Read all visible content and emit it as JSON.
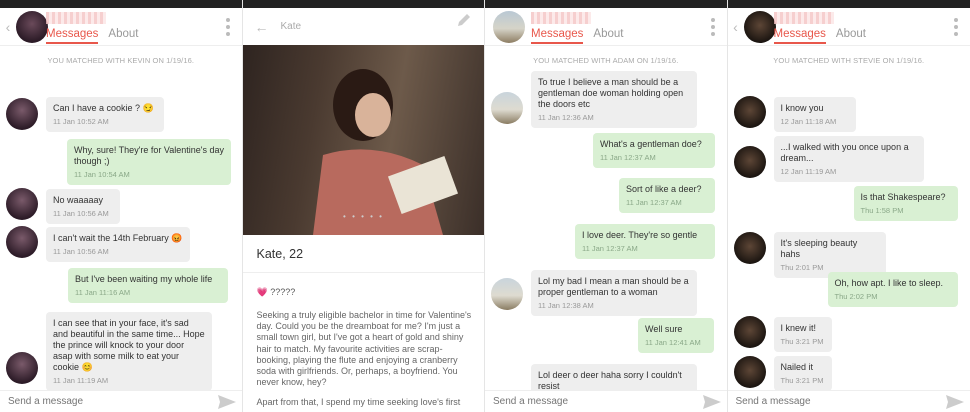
{
  "tabs": {
    "messages": "Messages",
    "about": "About"
  },
  "input_placeholder": "Send a message",
  "panel1": {
    "matched": "YOU MATCHED WITH KEVIN ON 1/19/16.",
    "messages": [
      {
        "dir": "in",
        "text": "Can I have a cookie ? 😏",
        "time": "11 Jan 10:52 AM"
      },
      {
        "dir": "out",
        "text": "Why, sure! They're for Valentine's day though ;)",
        "time": "11 Jan 10:54 AM"
      },
      {
        "dir": "in",
        "text": "No waaaaay",
        "time": "11 Jan 10:56 AM"
      },
      {
        "dir": "in",
        "text": "I can't wait the 14th February 😡",
        "time": "11 Jan 10:56 AM"
      },
      {
        "dir": "out",
        "text": "But I've been waiting my whole life",
        "time": "11 Jan 11:16 AM"
      },
      {
        "dir": "in",
        "text": "I can see that in your face, it's sad and beautiful in the same time... Hope the prince will knock to your door asap with some milk to eat your cookie 😊",
        "time": "11 Jan 11:19 AM"
      }
    ]
  },
  "panel2": {
    "header_name": "Kate",
    "title": "Kate, 22",
    "status": "💗 ?????",
    "bio": "Seeking a truly eligible bachelor in time for Valentine's day. Could you be the dreamboat for me? I'm just a small town girl, but I've got a heart of gold and shiny hair to match. My favourite activities are scrap-booking, playing the flute and enjoying a cranberry soda with girlfriends. Or, perhaps, a boyfriend. You never know, hey?",
    "bio2": "Apart from that, I spend my time seeking love's first",
    "photo_dots": "• • • • •"
  },
  "panel3": {
    "matched": "YOU MATCHED WITH ADAM ON 1/19/16.",
    "messages": [
      {
        "dir": "in",
        "text": "To true I believe a man should be a gentleman doe woman holding open the doors etc",
        "time": "11 Jan 12:36 AM"
      },
      {
        "dir": "out",
        "text": "What's a gentleman doe?",
        "time": "11 Jan 12:37 AM"
      },
      {
        "dir": "out",
        "text": "Sort of like a deer?",
        "time": "11 Jan 12:37 AM"
      },
      {
        "dir": "out",
        "text": "I love deer. They're so gentle",
        "time": "11 Jan 12:37 AM"
      },
      {
        "dir": "in",
        "text": "Lol my bad I mean a man should be a proper gentleman to a woman",
        "time": "11 Jan 12:38 AM"
      },
      {
        "dir": "out",
        "text": "Well sure",
        "time": "11 Jan 12:41 AM"
      },
      {
        "dir": "in",
        "text": "Lol deer o deer haha sorry I couldn't resist",
        "time": ""
      }
    ]
  },
  "panel4": {
    "matched": "YOU MATCHED WITH STEVIE ON 1/19/16.",
    "messages": [
      {
        "dir": "in",
        "text": "I know you",
        "time": "12 Jan 11:18 AM"
      },
      {
        "dir": "in",
        "text": "...I walked with you once upon a dream...",
        "time": "12 Jan 11:19 AM"
      },
      {
        "dir": "out",
        "text": "Is that Shakespeare?",
        "time": "Thu 1:58 PM"
      },
      {
        "dir": "in",
        "text": "It's sleeping beauty hahs",
        "time": "Thu 2:01 PM"
      },
      {
        "dir": "out",
        "text": "Oh, how apt. I like to sleep.",
        "time": "Thu 2:02 PM"
      },
      {
        "dir": "in",
        "text": "I knew it!",
        "time": "Thu 3:21 PM"
      },
      {
        "dir": "in",
        "text": "Nailed it",
        "time": "Thu 3:21 PM"
      }
    ]
  },
  "colors": {
    "accent": "#e8574b",
    "incoming": "#eeeeee",
    "outgoing": "#d9f0d3"
  }
}
